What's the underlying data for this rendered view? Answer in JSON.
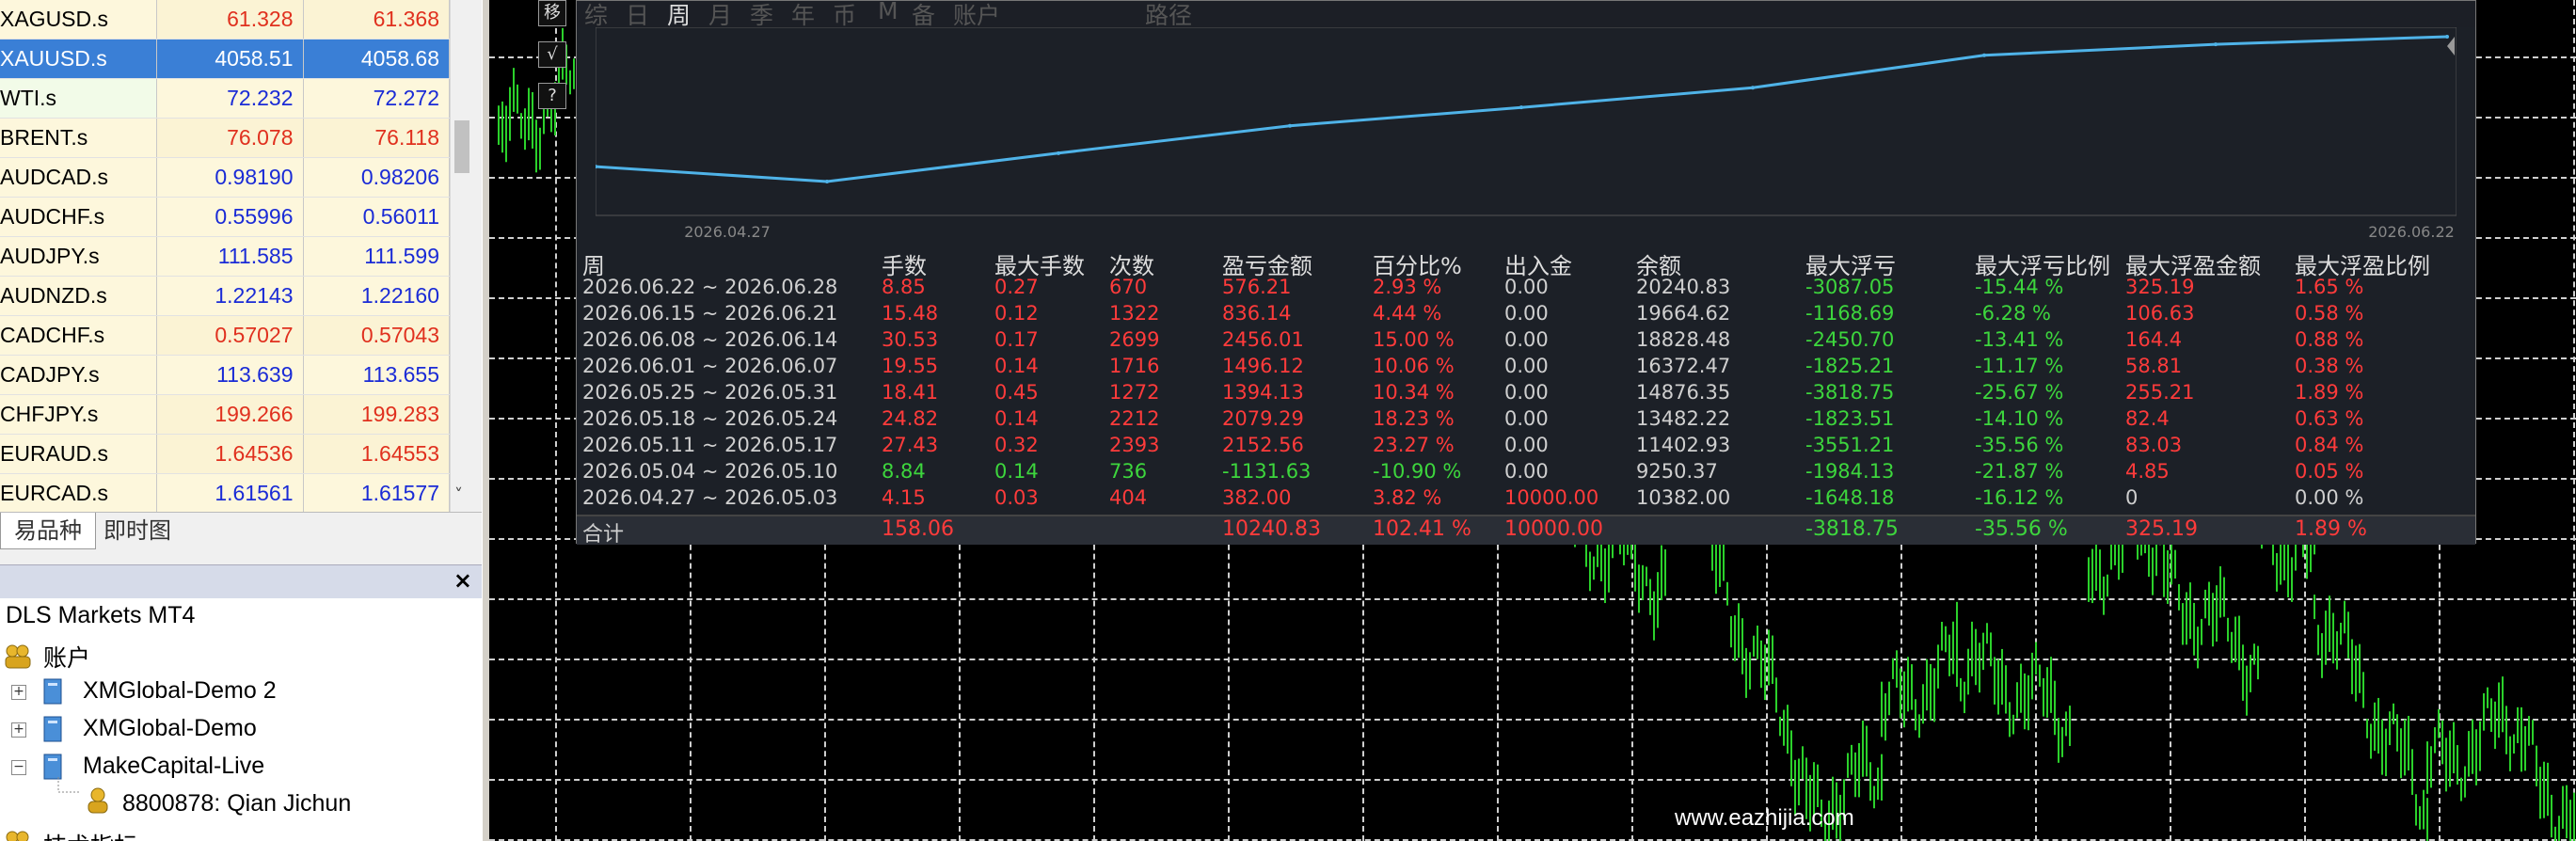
{
  "market_watch": {
    "rows": [
      {
        "symbol": "XAGUSD.s",
        "bid": "61.328",
        "ask": "61.368",
        "tone": "red"
      },
      {
        "symbol": "XAUUSD.s",
        "bid": "4058.51",
        "ask": "4058.68",
        "tone": "selected"
      },
      {
        "symbol": "WTI.s",
        "bid": "72.232",
        "ask": "72.272",
        "tone": "blue"
      },
      {
        "symbol": "BRENT.s",
        "bid": "76.078",
        "ask": "76.118",
        "tone": "red"
      },
      {
        "symbol": "AUDCAD.s",
        "bid": "0.98190",
        "ask": "0.98206",
        "tone": "blue"
      },
      {
        "symbol": "AUDCHF.s",
        "bid": "0.55996",
        "ask": "0.56011",
        "tone": "blue"
      },
      {
        "symbol": "AUDJPY.s",
        "bid": "111.585",
        "ask": "111.599",
        "tone": "blue"
      },
      {
        "symbol": "AUDNZD.s",
        "bid": "1.22143",
        "ask": "1.22160",
        "tone": "blue"
      },
      {
        "symbol": "CADCHF.s",
        "bid": "0.57027",
        "ask": "0.57043",
        "tone": "red"
      },
      {
        "symbol": "CADJPY.s",
        "bid": "113.639",
        "ask": "113.655",
        "tone": "blue"
      },
      {
        "symbol": "CHFJPY.s",
        "bid": "199.266",
        "ask": "199.283",
        "tone": "red"
      },
      {
        "symbol": "EURAUD.s",
        "bid": "1.64536",
        "ask": "1.64553",
        "tone": "red"
      },
      {
        "symbol": "EURCAD.s",
        "bid": "1.61561",
        "ask": "1.61577",
        "tone": "blue"
      }
    ],
    "tabs": [
      "易品种",
      "即时图"
    ],
    "scroll_down_glyph": "˅"
  },
  "navigator": {
    "title": "",
    "close_glyph": "×",
    "items": {
      "root": "DLS Markets MT4",
      "accounts": "账户",
      "acc1": "XMGlobal-Demo 2",
      "acc2": "XMGlobal-Demo",
      "acc3": "MakeCapital-Live",
      "login": "8800878: Qian Jichun",
      "indicators": "技术指标"
    },
    "expand_glyph": "+",
    "collapse_glyph": "−"
  },
  "chart_side_buttons": [
    "移",
    "√",
    "?"
  ],
  "watermark": "www.eazhijia.com",
  "stats_panel": {
    "tabs": [
      "综",
      "日",
      "周",
      "月",
      "季",
      "年",
      "币",
      "M",
      "备",
      "账户",
      "路径"
    ],
    "active_tab": "周",
    "graph": {
      "x_start_label": "2026.04.27",
      "x_end_label": "2026.06.22",
      "line_color": "#4fb3e8"
    },
    "columns": [
      "周",
      "手数",
      "最大手数",
      "次数",
      "盈亏金额",
      "百分比%",
      "出入金",
      "余额",
      "最大浮亏",
      "最大浮亏比例",
      "最大浮盈金额",
      "最大浮盈比例"
    ],
    "rows": [
      [
        "2026.06.22 ~ 2026.06.28",
        "8.85",
        "0.27",
        "670",
        "576.21",
        "2.93 %",
        "0.00",
        "20240.83",
        "-3087.05",
        "-15.44 %",
        "325.19",
        "1.65 %"
      ],
      [
        "2026.06.15 ~ 2026.06.21",
        "15.48",
        "0.12",
        "1322",
        "836.14",
        "4.44 %",
        "0.00",
        "19664.62",
        "-1168.69",
        "-6.28 %",
        "106.63",
        "0.58 %"
      ],
      [
        "2026.06.08 ~ 2026.06.14",
        "30.53",
        "0.17",
        "2699",
        "2456.01",
        "15.00 %",
        "0.00",
        "18828.48",
        "-2450.70",
        "-13.41 %",
        "164.4",
        "0.88 %"
      ],
      [
        "2026.06.01 ~ 2026.06.07",
        "19.55",
        "0.14",
        "1716",
        "1496.12",
        "10.06 %",
        "0.00",
        "16372.47",
        "-1825.21",
        "-11.17 %",
        "58.81",
        "0.38 %"
      ],
      [
        "2026.05.25 ~ 2026.05.31",
        "18.41",
        "0.45",
        "1272",
        "1394.13",
        "10.34 %",
        "0.00",
        "14876.35",
        "-3818.75",
        "-25.67 %",
        "255.21",
        "1.89 %"
      ],
      [
        "2026.05.18 ~ 2026.05.24",
        "24.82",
        "0.14",
        "2212",
        "2079.29",
        "18.23 %",
        "0.00",
        "13482.22",
        "-1823.51",
        "-14.10 %",
        "82.4",
        "0.63 %"
      ],
      [
        "2026.05.11 ~ 2026.05.17",
        "27.43",
        "0.32",
        "2393",
        "2152.56",
        "23.27 %",
        "0.00",
        "11402.93",
        "-3551.21",
        "-35.56 %",
        "83.03",
        "0.84 %"
      ],
      [
        "2026.05.04 ~ 2026.05.10",
        "8.84",
        "0.14",
        "736",
        "-1131.63",
        "-10.90 %",
        "0.00",
        "9250.37",
        "-1984.13",
        "-21.87 %",
        "4.85",
        "0.05 %"
      ],
      [
        "2026.04.27 ~ 2026.05.03",
        "4.15",
        "0.03",
        "404",
        "382.00",
        "3.82 %",
        "10000.00",
        "10382.00",
        "-1648.18",
        "-16.12 %",
        "0",
        "0.00 %"
      ]
    ],
    "row_tones": [
      "red",
      "red",
      "red",
      "red",
      "red",
      "red",
      "red",
      "green",
      "red"
    ],
    "total": [
      "合计",
      "158.06",
      "",
      "",
      "10240.83",
      "102.41 %",
      "10000.00",
      "",
      "-3818.75",
      "-35.56 %",
      "325.19",
      "1.89 %"
    ]
  },
  "chart_data": {
    "type": "line",
    "x": [
      "2026.04.27",
      "2026.05.04",
      "2026.05.11",
      "2026.05.18",
      "2026.05.25",
      "2026.06.01",
      "2026.06.08",
      "2026.06.15",
      "2026.06.22"
    ],
    "series": [
      {
        "values": [
          10382.0,
          9250.37,
          11402.93,
          13482.22,
          14876.35,
          16372.47,
          18828.48,
          19664.62,
          20240.83
        ]
      }
    ],
    "xlabel": "",
    "ylabel": "",
    "grid": false
  },
  "colors": {
    "red": "#ff3b3b",
    "green": "#3dd63d",
    "price_blue": "#1a2bd6",
    "price_red": "#e0301e",
    "selected": "#3a7fd6",
    "candle_green": "#2bd12b"
  }
}
